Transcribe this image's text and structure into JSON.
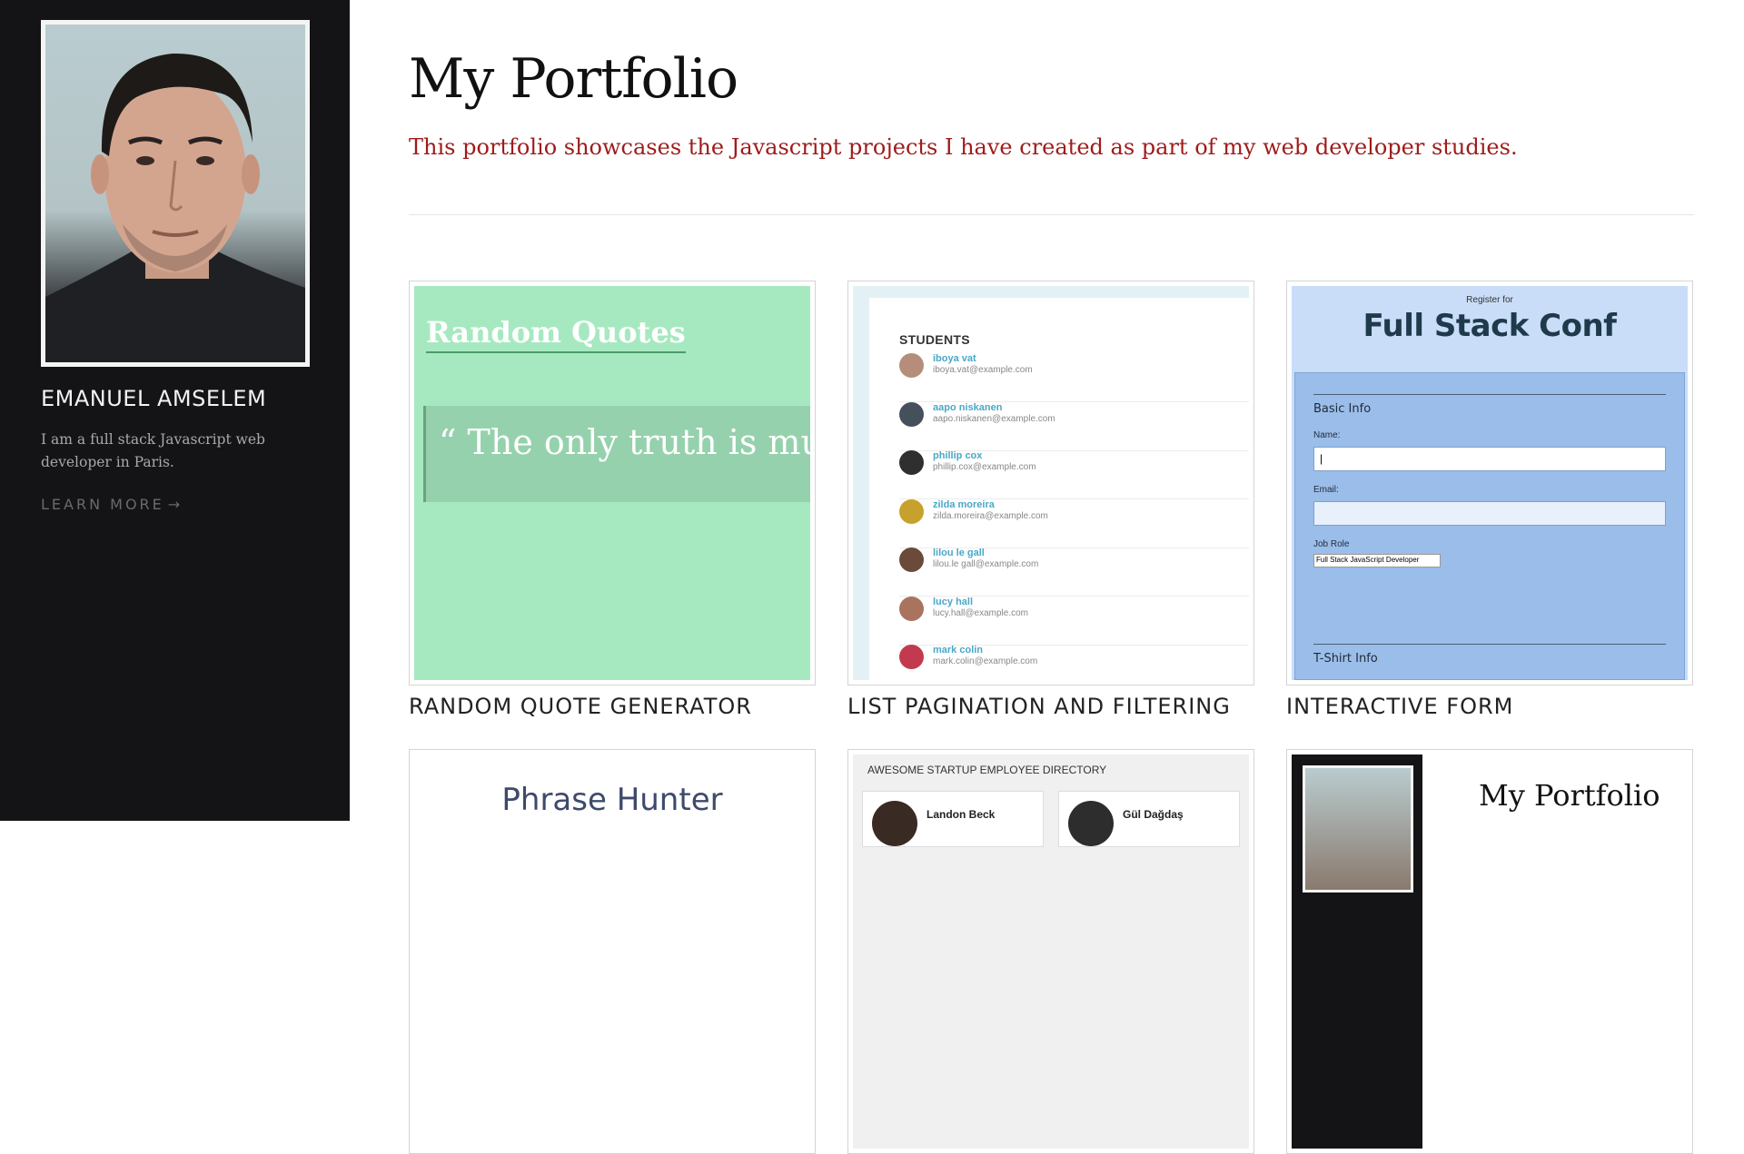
{
  "sidebar": {
    "name": "EMANUEL AMSELEM",
    "bio": "I am a full stack Javascript web developer in Paris.",
    "learn_more": "LEARN MORE",
    "arrow": "→"
  },
  "header": {
    "title": "My Portfolio",
    "subtitle": "This portfolio showcases the Javascript projects I have created as part of my web developer studies."
  },
  "projects": [
    {
      "title": "RANDOM QUOTE GENERATOR",
      "thumb": {
        "heading": "Random Quotes",
        "quote_mark": "“",
        "quote": "The only truth is musi",
        "bg": "#a6e9c0"
      }
    },
    {
      "title": "LIST PAGINATION AND FILTERING",
      "thumb": {
        "heading": "STUDENTS",
        "students": [
          {
            "name": "iboya vat",
            "email": "iboya.vat@example.com"
          },
          {
            "name": "aapo niskanen",
            "email": "aapo.niskanen@example.com"
          },
          {
            "name": "phillip cox",
            "email": "phillip.cox@example.com"
          },
          {
            "name": "zilda moreira",
            "email": "zilda.moreira@example.com"
          },
          {
            "name": "lilou le gall",
            "email": "lilou.le gall@example.com"
          },
          {
            "name": "lucy hall",
            "email": "lucy.hall@example.com"
          },
          {
            "name": "mark colin",
            "email": "mark.colin@example.com"
          }
        ]
      }
    },
    {
      "title": "INTERACTIVE FORM",
      "thumb": {
        "small": "Register for",
        "heading": "Full Stack Conf",
        "section1": "Basic Info",
        "name_label": "Name:",
        "name_value": "|",
        "email_label": "Email:",
        "job_label": "Job Role",
        "job_value": "Full Stack JavaScript Developer",
        "section2": "T-Shirt Info"
      }
    },
    {
      "title": "",
      "thumb": {
        "heading": "Phrase Hunter"
      }
    },
    {
      "title": "",
      "thumb": {
        "heading": "AWESOME STARTUP EMPLOYEE DIRECTORY",
        "employees": [
          {
            "name": "Landon Beck"
          },
          {
            "name": "Gül Dağdaş"
          }
        ]
      }
    },
    {
      "title": "",
      "thumb": {
        "heading": "My Portfolio"
      }
    }
  ]
}
